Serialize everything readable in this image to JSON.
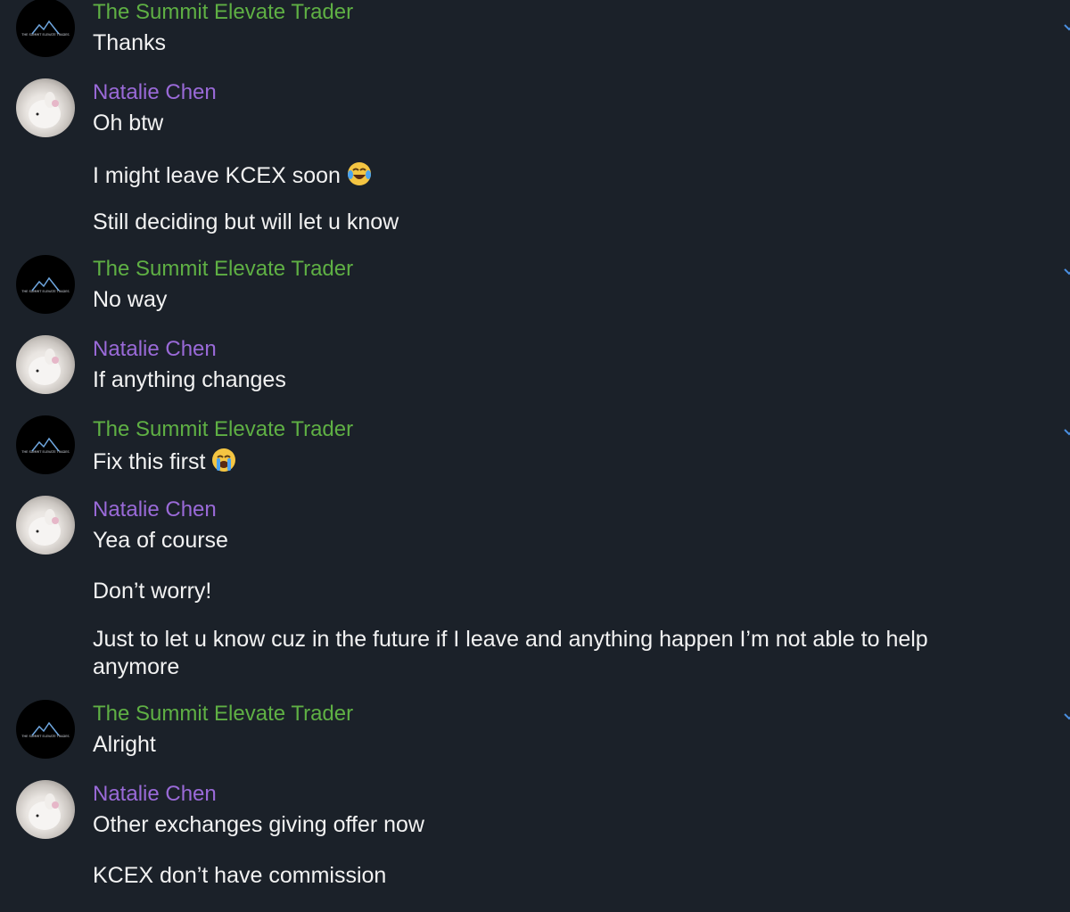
{
  "participants": {
    "summit": {
      "name": "The Summit Elevate Trader",
      "color": "#5fb044",
      "logo_text": "THE SUMMIT ELEVATE TRADES"
    },
    "natalie": {
      "name": "Natalie Chen",
      "color": "#9a6ad8"
    }
  },
  "messages": [
    {
      "sender": "The Summit Elevate Trader",
      "lines": [
        "Thanks"
      ]
    },
    {
      "sender": "Natalie Chen",
      "lines": [
        "Oh btw",
        "I might leave KCEX soon",
        "Still deciding but will let u know"
      ],
      "emoji": "face-with-tears-of-joy"
    },
    {
      "sender": "The Summit Elevate Trader",
      "lines": [
        "No way"
      ]
    },
    {
      "sender": "Natalie Chen",
      "lines": [
        "If anything changes"
      ]
    },
    {
      "sender": "The Summit Elevate Trader",
      "lines": [
        "Fix this first"
      ],
      "emoji": "loudly-crying-face"
    },
    {
      "sender": "Natalie Chen",
      "lines": [
        "Yea of course",
        "Don’t worry!",
        "Just to let u know cuz in the future if I leave and anything happen I’m not able to help anymore"
      ]
    },
    {
      "sender": "The Summit Elevate Trader",
      "lines": [
        "Alright"
      ]
    },
    {
      "sender": "Natalie Chen",
      "lines": [
        "Other exchanges giving offer now",
        "KCEX don’t have commission"
      ]
    }
  ]
}
